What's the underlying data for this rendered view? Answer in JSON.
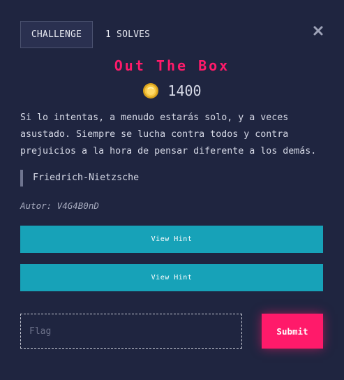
{
  "tabs": {
    "challenge_label": "CHALLENGE",
    "solves_label": "1 SOLVES"
  },
  "challenge": {
    "title": "Out The Box",
    "value": "1400",
    "description": "Si lo intentas, a menudo estarás solo, y a veces asustado. Siempre se lucha contra todos y contra prejuicios a la hora de pensar diferente a los demás.",
    "quote": "Friedrich-Nietzsche",
    "author": "Autor: V4G4B0nD"
  },
  "hints": [
    {
      "label": "View Hint"
    },
    {
      "label": "View Hint"
    }
  ],
  "flag_form": {
    "placeholder": "Flag",
    "value": "",
    "submit_label": "Submit"
  },
  "icons": {
    "close": "close-icon",
    "coin": "coin-icon"
  },
  "colors": {
    "background": "#1f2540",
    "accent": "#ff1a6a",
    "hint_button": "#17a2b8"
  }
}
